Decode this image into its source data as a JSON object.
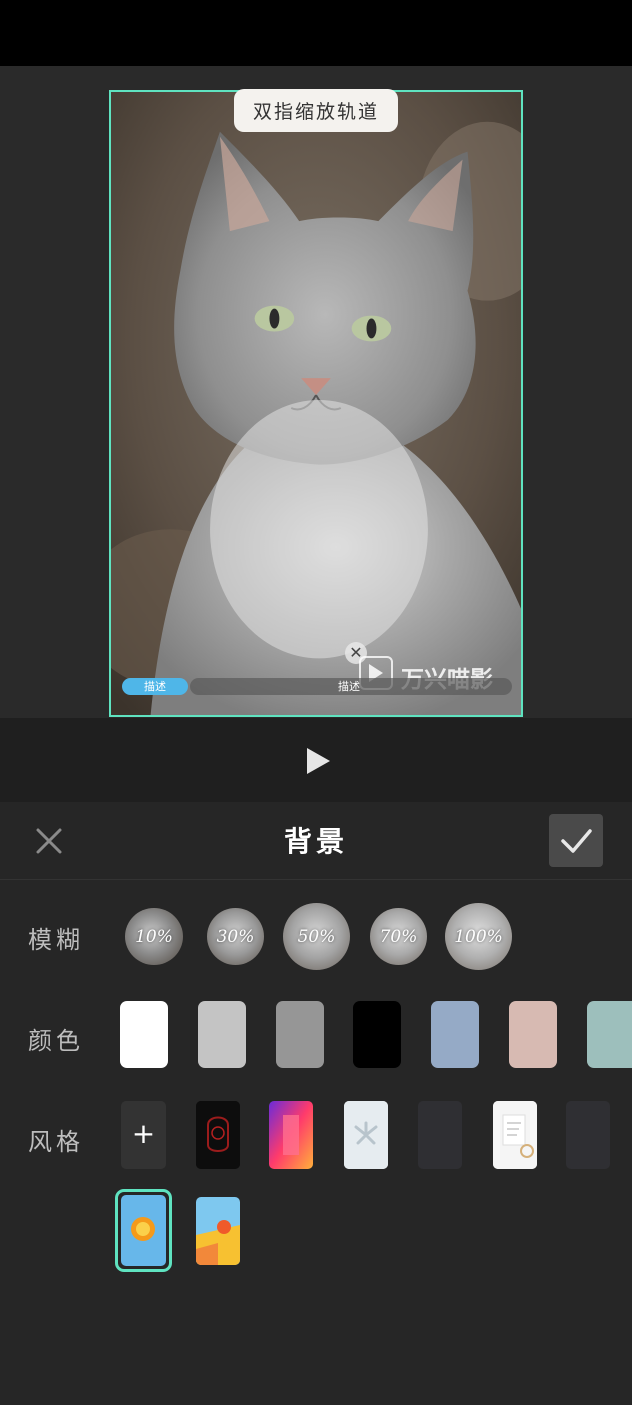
{
  "preview": {
    "tip": "双指缩放轨道",
    "watermark_text": "万兴喵影",
    "track_chip_label": "描述",
    "track_label": "描述"
  },
  "panel": {
    "title": "背景",
    "close_icon": "close-icon",
    "confirm_icon": "check-icon"
  },
  "blur": {
    "label": "模糊",
    "options": [
      "10%",
      "30%",
      "50%",
      "70%",
      "100%"
    ]
  },
  "color": {
    "label": "颜色",
    "swatches": [
      "#ffffff",
      "#c4c4c4",
      "#969696",
      "#000000",
      "#95aac6",
      "#d7bab2",
      "#9dbfbc"
    ]
  },
  "style": {
    "label": "风格",
    "add_label": "+",
    "selected_index": 7
  }
}
